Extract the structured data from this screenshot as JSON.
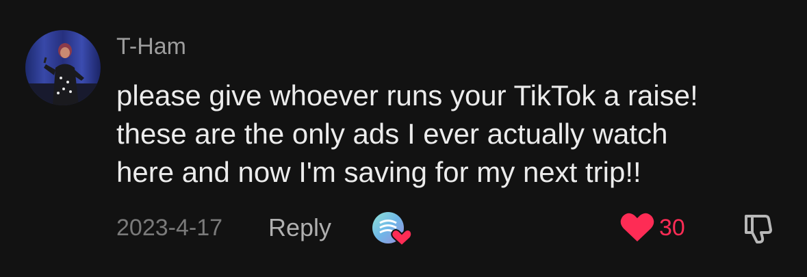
{
  "comment": {
    "username": "T-Ham",
    "text_lines": [
      "please give whoever runs your TikTok a raise!",
      "these are the only ads I ever actually watch",
      "here and now I'm saving for my next trip!!"
    ],
    "date": "2023-4-17",
    "reply_label": "Reply",
    "like_count": "30"
  },
  "icons": {
    "avatar": "user-avatar",
    "creator_like": "creator-liked-badge-icon",
    "like": "heart-icon",
    "dislike": "thumbs-down-icon"
  },
  "colors": {
    "background": "#121212",
    "username": "#9d9d9d",
    "text": "#ececec",
    "date": "#7a7a7a",
    "reply": "#b0b0b0",
    "like_accent": "#fe2c55"
  }
}
